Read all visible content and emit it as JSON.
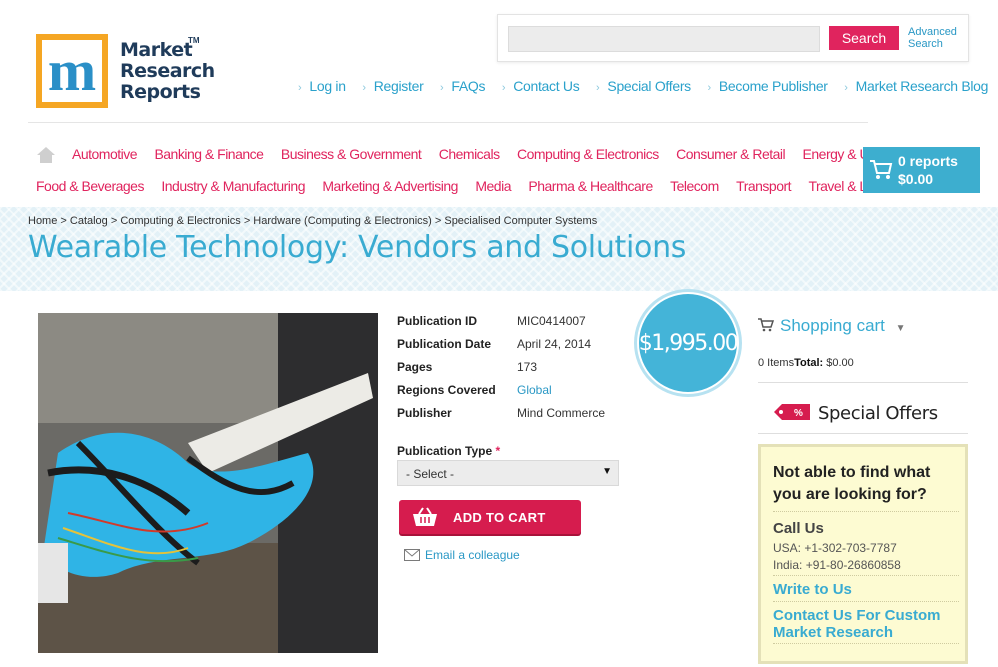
{
  "logo": {
    "line1": "Market",
    "line2": "Research",
    "line3": "Reports",
    "tm": "TM",
    "letter": "m"
  },
  "search": {
    "placeholder": "",
    "button_label": "Search",
    "advanced_label": "Advanced Search"
  },
  "top_links": [
    "Log in",
    "Register",
    "FAQs",
    "Contact Us",
    "Special Offers",
    "Become Publisher",
    "Market Research Blog"
  ],
  "categories_row1": [
    "Automotive",
    "Banking & Finance",
    "Business & Government",
    "Chemicals",
    "Computing & Electronics",
    "Consumer & Retail",
    "Energy & Utilities"
  ],
  "categories_row2": [
    "Food & Beverages",
    "Industry & Manufacturing",
    "Marketing & Advertising",
    "Media",
    "Pharma & Healthcare",
    "Telecom",
    "Transport",
    "Travel & Leisure"
  ],
  "cart": {
    "reports": "0 reports",
    "total": "$0.00"
  },
  "breadcrumb": "Home > Catalog > Computing & Electronics > Hardware (Computing & Electronics) > Specialised Computer Systems",
  "title": "Wearable Technology: Vendors and Solutions",
  "details": [
    {
      "label": "Publication ID",
      "value": "MIC0414007"
    },
    {
      "label": "Publication Date",
      "value": "April 24, 2014"
    },
    {
      "label": "Pages",
      "value": "173"
    },
    {
      "label": "Regions Covered",
      "value": "Global"
    },
    {
      "label": "Publisher",
      "value": "Mind Commerce"
    }
  ],
  "price": "$1,995.00",
  "publication_type": {
    "label": "Publication Type",
    "required_mark": "*",
    "selected": "- Select -"
  },
  "add_to_cart_label": "ADD TO CART",
  "email_colleague_label": "Email a colleague",
  "shopping_cart": {
    "title": "Shopping cart",
    "items": "0 Items",
    "total_label": "Total:",
    "total_value": "$0.00"
  },
  "special_offers": {
    "label": "Special Offers",
    "tag": "%"
  },
  "help_box": {
    "question": "Not able to find what you are looking for?",
    "call_us": "Call Us",
    "usa": "USA: +1-302-703-7787",
    "india": "India: +91-80-26860858",
    "write_to_us": "Write to Us",
    "contact_custom": "Contact Us For Custom Market Research"
  },
  "colors": {
    "accent_pink": "#e0245e",
    "accent_blue": "#39abd1",
    "logo_orange": "#f5a623"
  }
}
